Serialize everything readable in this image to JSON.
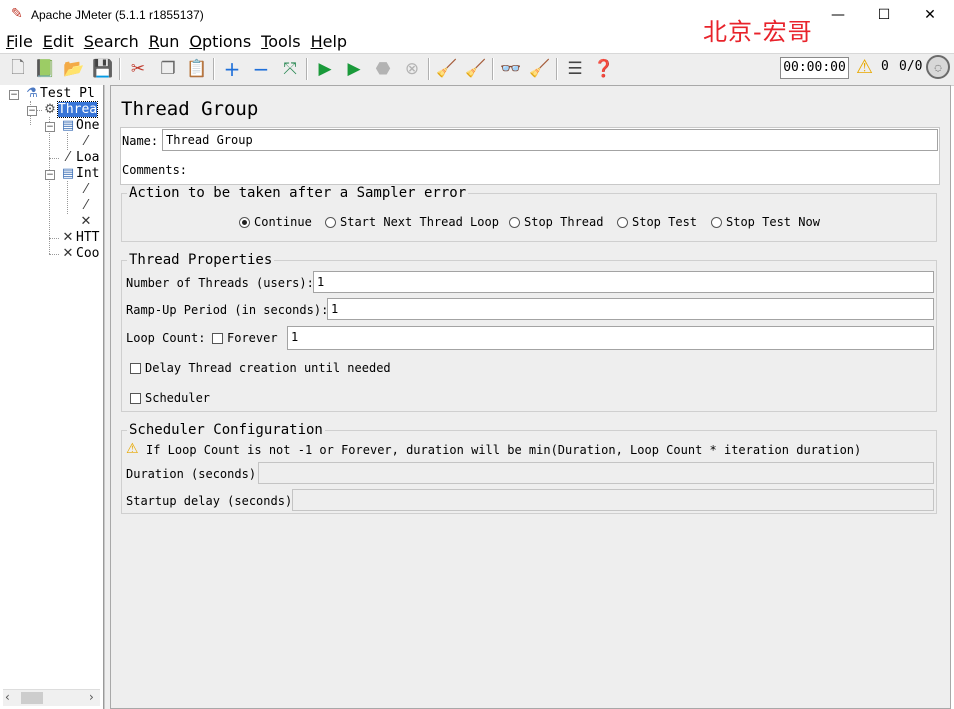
{
  "window": {
    "title": "Apache JMeter (5.1.1 r1855137)",
    "watermark": "北京-宏哥",
    "controls": {
      "minimize": "—",
      "maximize": "☐",
      "close": "✕"
    }
  },
  "menu": [
    "File",
    "Edit",
    "Search",
    "Run",
    "Options",
    "Tools",
    "Help"
  ],
  "toolbar": {
    "icons": [
      "new-icon",
      "templates-icon",
      "open-icon",
      "save-icon",
      "cut-icon",
      "copy-icon",
      "paste-icon",
      "expand-icon",
      "collapse-icon",
      "toggle-icon",
      "start-icon",
      "start-no-pause-icon",
      "stop-icon",
      "shutdown-icon",
      "clear-icon",
      "clear-all-icon",
      "search-icon",
      "reset-search-icon",
      "function-helper-icon",
      "help-icon"
    ],
    "timer": "00:00:00",
    "warning_count": "0",
    "threads": "0/0"
  },
  "tree": {
    "nodes": [
      "Test Pl",
      "Threa",
      "One",
      "Loa",
      "Int",
      "HTT",
      "Coo"
    ]
  },
  "panel": {
    "title": "Thread Group",
    "name_label": "Name:",
    "name_value": "Thread Group",
    "comments_label": "Comments:",
    "sampler_error": {
      "title": "Action to be taken after a Sampler error",
      "options": [
        "Continue",
        "Start Next Thread Loop",
        "Stop Thread",
        "Stop Test",
        "Stop Test Now"
      ],
      "selected": "Continue"
    },
    "thread_properties": {
      "title": "Thread Properties",
      "num_threads_label": "Number of Threads (users):",
      "num_threads_value": "1",
      "ramp_up_label": "Ramp-Up Period (in seconds):",
      "ramp_up_value": "1",
      "loop_count_label": "Loop Count:",
      "forever_label": "Forever",
      "loop_count_value": "1",
      "delay_label": "Delay Thread creation until needed",
      "scheduler_label": "Scheduler"
    },
    "scheduler_config": {
      "title": "Scheduler Configuration",
      "warning": "If Loop Count is not -1 or Forever, duration will be min(Duration, Loop Count * iteration duration)",
      "duration_label": "Duration (seconds)",
      "startup_delay_label": "Startup delay (seconds)"
    }
  }
}
